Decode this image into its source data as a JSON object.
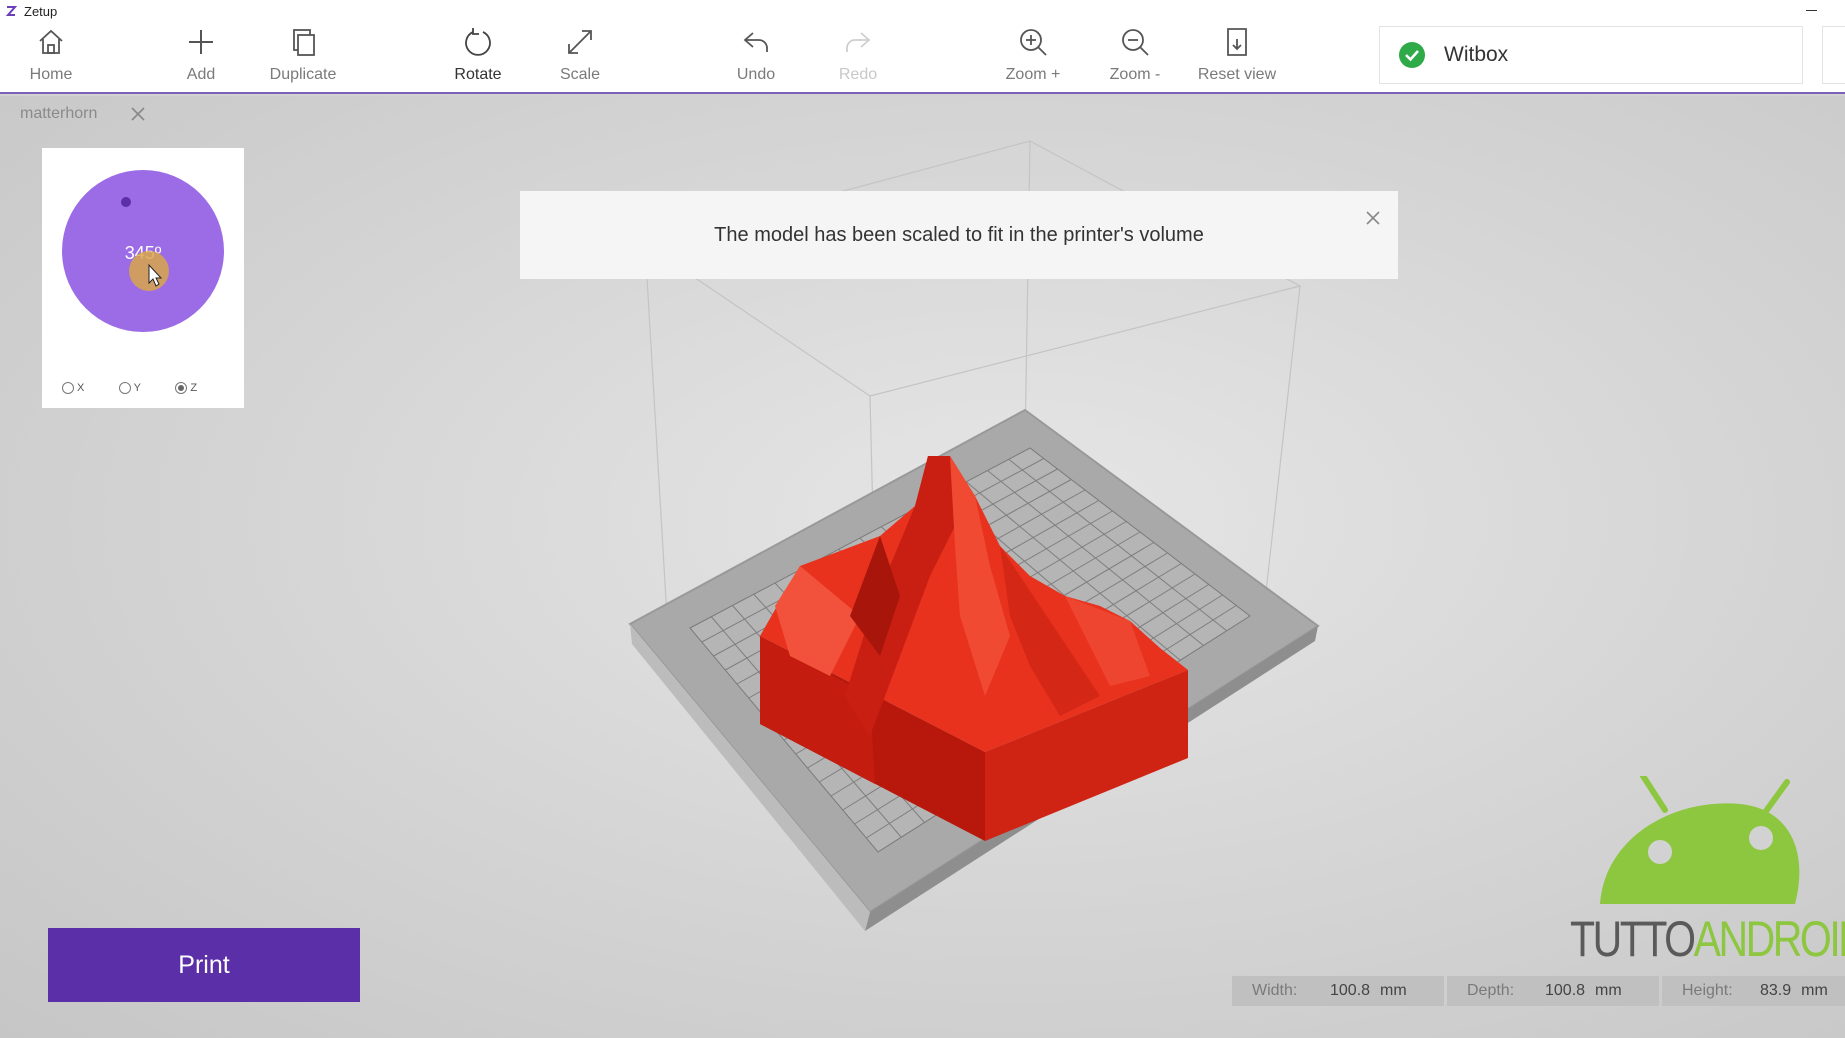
{
  "window": {
    "title": "Zetup"
  },
  "toolbar": {
    "items": [
      {
        "label": "Home",
        "icon": "home-icon",
        "state": "normal"
      },
      {
        "label": "Add",
        "icon": "plus-icon",
        "state": "normal"
      },
      {
        "label": "Duplicate",
        "icon": "duplicate-icon",
        "state": "normal"
      },
      {
        "label": "Rotate",
        "icon": "rotate-icon",
        "state": "active"
      },
      {
        "label": "Scale",
        "icon": "scale-icon",
        "state": "normal"
      },
      {
        "label": "Undo",
        "icon": "undo-icon",
        "state": "normal"
      },
      {
        "label": "Redo",
        "icon": "redo-icon",
        "state": "disabled"
      },
      {
        "label": "Zoom +",
        "icon": "zoom-in-icon",
        "state": "normal"
      },
      {
        "label": "Zoom -",
        "icon": "zoom-out-icon",
        "state": "normal"
      },
      {
        "label": "Reset view",
        "icon": "reset-view-icon",
        "state": "normal"
      }
    ],
    "printer": {
      "name": "Witbox",
      "status_icon": "check-circle-icon",
      "status_color": "#2eaa49"
    }
  },
  "model_tab": {
    "name": "matterhorn"
  },
  "rotate_panel": {
    "angle_label": "345º",
    "angle_value": 345,
    "axes": [
      {
        "label": "X",
        "checked": false
      },
      {
        "label": "Y",
        "checked": false
      },
      {
        "label": "Z",
        "checked": true
      }
    ],
    "dial_color": "#9b6ce6"
  },
  "notification": {
    "message": "The model has been scaled to fit in the printer's volume"
  },
  "print_button": {
    "label": "Print",
    "color": "#5b2fa8"
  },
  "dimensions": [
    {
      "label": "Width:",
      "value": "100.8",
      "unit": "mm"
    },
    {
      "label": "Depth:",
      "value": "100.8",
      "unit": "mm"
    },
    {
      "label": "Height:",
      "value": "83.9",
      "unit": "mm"
    }
  ],
  "watermark": {
    "text_part1": "TUTTO",
    "text_part2": "ANDROID",
    "color_part2": "#8dc63f"
  },
  "model_color": "#e8321e"
}
